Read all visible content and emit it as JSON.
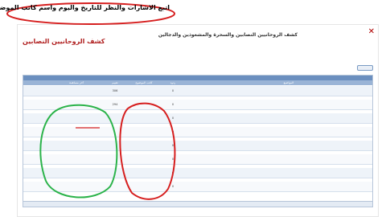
{
  "annotation": {
    "note_text": "اتبع الاشارات والنظر للتاريخ واليوم واسم كاتب الموضوع",
    "note_color": "#d61f1f",
    "green_circle_color": "#2bb34a",
    "red_circle_color": "#d61f1f"
  },
  "header": {
    "site_title": "كشف الروحانيين النصابين والسحرة والمشعوذين والدجالين",
    "logo_text": "كشف الروحانيين النصابين",
    "description": "",
    "close_icon": "close-icon"
  },
  "nav": {
    "items": [
      "",
      "",
      "",
      "",
      "",
      "",
      "",
      ""
    ]
  },
  "breadcrumb": {
    "new_topic_label": "",
    "path": ""
  },
  "table": {
    "header_bg": "#6b8fbf",
    "columns": {
      "title": "المواضيع",
      "replies": "ردود",
      "author": "كاتب الموضوع",
      "views": "تقييم",
      "last_post": "آخر مساهمة"
    },
    "forum_label": "",
    "rows": [
      {
        "title": "",
        "replies": "0",
        "author": "",
        "views": "306",
        "last_date": "",
        "last_by": ""
      },
      {
        "title": "",
        "replies": "0",
        "author": "",
        "views": "294",
        "last_date": "",
        "last_by": ""
      },
      {
        "title": "",
        "replies": "0",
        "author": "",
        "views": "",
        "last_date": "",
        "last_by": ""
      },
      {
        "title": "",
        "replies": "0",
        "author": "",
        "views": "",
        "last_date": "",
        "last_by": ""
      },
      {
        "title": "",
        "replies": "0",
        "author": "",
        "views": "",
        "last_date": "",
        "last_by": ""
      },
      {
        "title": "",
        "replies": "0",
        "author": "",
        "views": "",
        "last_date": "",
        "last_by": ""
      },
      {
        "title": "",
        "replies": "0",
        "author": "",
        "views": "",
        "last_date": "",
        "last_by": ""
      },
      {
        "title": "",
        "replies": "0",
        "author": "",
        "views": "",
        "last_date": "",
        "last_by": ""
      }
    ],
    "footer_text": ""
  }
}
